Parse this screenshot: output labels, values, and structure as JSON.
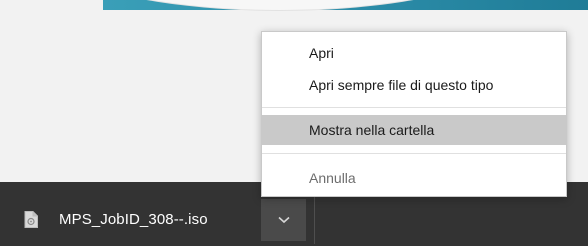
{
  "downloads_bar": {
    "file_name": "MPS_JobID_308--.iso"
  },
  "context_menu": {
    "items": [
      {
        "label": "Apri"
      },
      {
        "label": "Apri sempre file di questo tipo"
      },
      {
        "label": "Mostra nella cartella",
        "highlighted": true
      },
      {
        "label": "Annulla",
        "disabled": true
      }
    ]
  },
  "icons": {
    "file": "file-icon",
    "chevron": "chevron-down-icon"
  },
  "colors": {
    "bar_background": "#333333",
    "button_background": "#4a4a4a",
    "menu_highlight": "#c9c9c9",
    "accent": "#2a8aa6"
  }
}
